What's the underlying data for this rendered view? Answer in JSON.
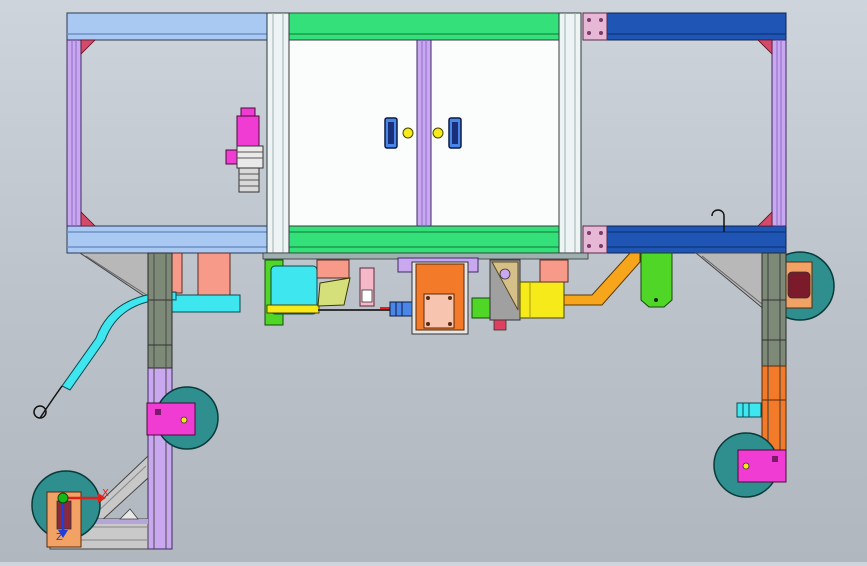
{
  "viewport": {
    "background_top": "#ced4db",
    "background_bottom": "#b1b7bf"
  },
  "triad": {
    "x_label": "X",
    "z_label": "Z",
    "x_color": "#e0201a",
    "z_color": "#1f3fd8",
    "origin_color": "#16b816"
  },
  "colors": {
    "frame_left": "#a9c8f2",
    "frame_center": "#33e07a",
    "frame_right": "#1f55b4",
    "pillar_white": "#eef4f4",
    "violet": "#c9a8f0",
    "magenta": "#f03cd2",
    "teal_wheel": "#2f8f8f",
    "cyan": "#3ee6f0",
    "orange": "#f27a28",
    "yellow": "#f7ea1a",
    "lime": "#4fd626",
    "salmon": "#f79a8a",
    "door_white": "#fbfdfd",
    "handle_blue": "#4a86e8"
  },
  "icons": {
    "view_triad": "axis-triad-icon"
  }
}
